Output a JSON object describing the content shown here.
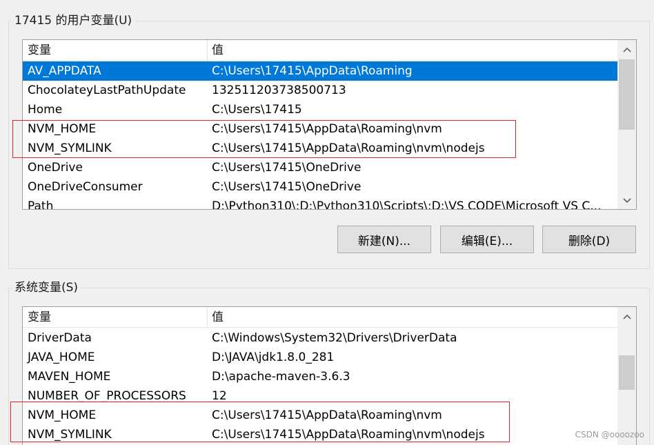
{
  "user_vars": {
    "title": "17415 的用户变量(U)",
    "columns": {
      "name": "变量",
      "value": "值"
    },
    "rows": [
      {
        "name": "AV_APPDATA",
        "value": "C:\\Users\\17415\\AppData\\Roaming",
        "selected": true
      },
      {
        "name": "ChocolateyLastPathUpdate",
        "value": "132511203738500713"
      },
      {
        "name": "Home",
        "value": "C:\\Users\\17415"
      },
      {
        "name": "NVM_HOME",
        "value": "C:\\Users\\17415\\AppData\\Roaming\\nvm"
      },
      {
        "name": "NVM_SYMLINK",
        "value": "C:\\Users\\17415\\AppData\\Roaming\\nvm\\nodejs"
      },
      {
        "name": "OneDrive",
        "value": "C:\\Users\\17415\\OneDrive"
      },
      {
        "name": "OneDriveConsumer",
        "value": "C:\\Users\\17415\\OneDrive"
      },
      {
        "name": "Path",
        "value": "D:\\Python310\\;D:\\Python310\\Scripts\\;D:\\VS CODE\\Microsoft VS C..."
      }
    ],
    "buttons": {
      "new": "新建(N)...",
      "edit": "编辑(E)...",
      "delete": "删除(D)"
    }
  },
  "system_vars": {
    "title": "系统变量(S)",
    "columns": {
      "name": "变量",
      "value": "值"
    },
    "rows": [
      {
        "name": "DriverData",
        "value": "C:\\Windows\\System32\\Drivers\\DriverData"
      },
      {
        "name": "JAVA_HOME",
        "value": "D:\\JAVA\\jdk1.8.0_281"
      },
      {
        "name": "MAVEN_HOME",
        "value": "D:\\apache-maven-3.6.3"
      },
      {
        "name": "NUMBER_OF_PROCESSORS",
        "value": "12"
      },
      {
        "name": "NVM_HOME",
        "value": "C:\\Users\\17415\\AppData\\Roaming\\nvm"
      },
      {
        "name": "NVM_SYMLINK",
        "value": "C:\\Users\\17415\\AppData\\Roaming\\nvm\\nodejs"
      }
    ]
  },
  "icons": {
    "scroll_up": "chevron-up-icon",
    "scroll_down": "chevron-down-icon"
  },
  "colors": {
    "selection": "#0078d7",
    "highlight_box": "#e0242b"
  },
  "watermark": "CSDN @oooozoo"
}
